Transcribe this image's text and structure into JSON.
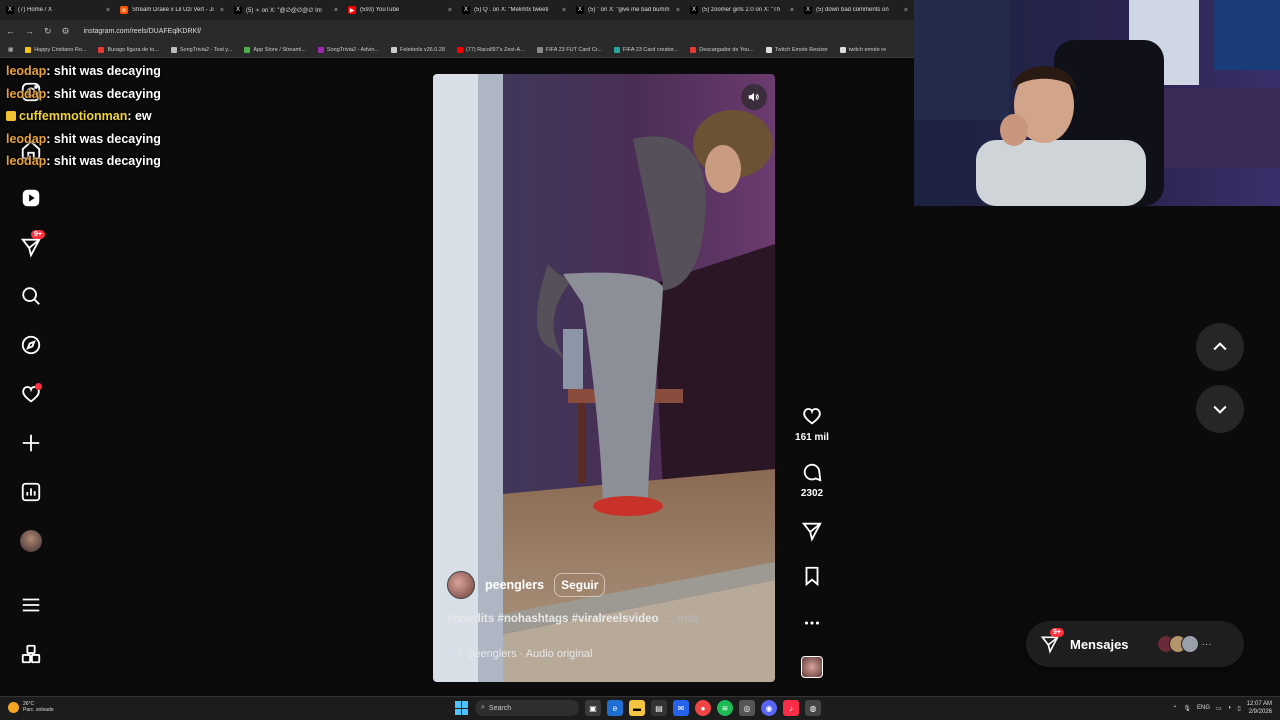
{
  "tabs": [
    {
      "title": "(7) Home / X",
      "icon": "x-logo-icon",
      "color": "#000000"
    },
    {
      "title": "Stream Drake x Lil Uzi Vert - Ji",
      "icon": "soundcloud-icon",
      "color": "#ff5500"
    },
    {
      "title": "(5) ∻ on X: \"@∅@∅@∅ Im",
      "icon": "x-logo-icon",
      "color": "#000000"
    },
    {
      "title": "(593) YouTube",
      "icon": "youtube-icon",
      "color": "#ff0000"
    },
    {
      "title": "(5) Q . on X: \"Melimtx tweeti",
      "icon": "x-logo-icon",
      "color": "#000000"
    },
    {
      "title": "(5) ˚ on X: \"give me bad bumm",
      "icon": "x-logo-icon",
      "color": "#000000"
    },
    {
      "title": "(5) zoomer girls 2.0 on X: \"Th",
      "icon": "x-logo-icon",
      "color": "#000000"
    },
    {
      "title": "(5) down bad comments on",
      "icon": "x-logo-icon",
      "color": "#000000"
    }
  ],
  "address": {
    "url": "instagram.com/reels/DUAFEqlKDRKf/"
  },
  "bookmarks": [
    {
      "label": "Happy Cristiano Ro...",
      "color": "#f5c518"
    },
    {
      "label": "Burago figura de to...",
      "color": "#e53935"
    },
    {
      "label": "SongTrivia2 - Test y...",
      "color": "#bbbbbb"
    },
    {
      "label": "App Store / Streaml...",
      "color": "#4caf50"
    },
    {
      "label": "SongTrivia2 - Advin...",
      "color": "#9c27b0"
    },
    {
      "label": "Feletools v26.0.28",
      "color": "#cccccc"
    },
    {
      "label": "(77) Racoll97's Zest-A...",
      "color": "#ff0000"
    },
    {
      "label": "FIFA 23 FUT Card Cr...",
      "color": "#888888"
    },
    {
      "label": "FIFA 23 Card creator...",
      "color": "#26a69a"
    },
    {
      "label": "Descargador de You...",
      "color": "#e53935"
    },
    {
      "label": "Twitch Emote Resizer",
      "color": "#dddddd"
    },
    {
      "label": "twitch emote re",
      "color": "#dddddd"
    }
  ],
  "chat": [
    {
      "user": "leodap",
      "msg": ": shit was decaying",
      "color": "orange"
    },
    {
      "user": "leodap",
      "msg": ": shit was decaying",
      "color": "orange"
    },
    {
      "user": "cuffemmotionman",
      "msg": ": ew",
      "color": "yellow",
      "badge": true
    },
    {
      "user": "leodap",
      "msg": ": shit was decaying",
      "color": "orange"
    },
    {
      "user": "leodap",
      "msg": ": shit was decaying",
      "color": "orange"
    }
  ],
  "nav": {
    "messages_badge": "9+"
  },
  "reel": {
    "author": "peenglers",
    "follow_label": "Seguir",
    "caption": "#noedits #nohashtags #viralreelsvideo",
    "more_label": "... más",
    "audio": "peenglers · Audio original"
  },
  "actions": {
    "likes": "161 mil",
    "comments": "2302"
  },
  "messages": {
    "label": "Mensajes",
    "badge": "9+"
  },
  "taskbar": {
    "weather_temp": "26°C",
    "weather_desc": "Parc. soleado",
    "search_label": "Search",
    "lang": "ENG",
    "time": "12:07 AM",
    "date": "2/9/2026"
  },
  "colors": {
    "accent_red": "#ff3040",
    "chat_orange": "#e8a33c",
    "chat_yellow": "#f1d33d"
  }
}
